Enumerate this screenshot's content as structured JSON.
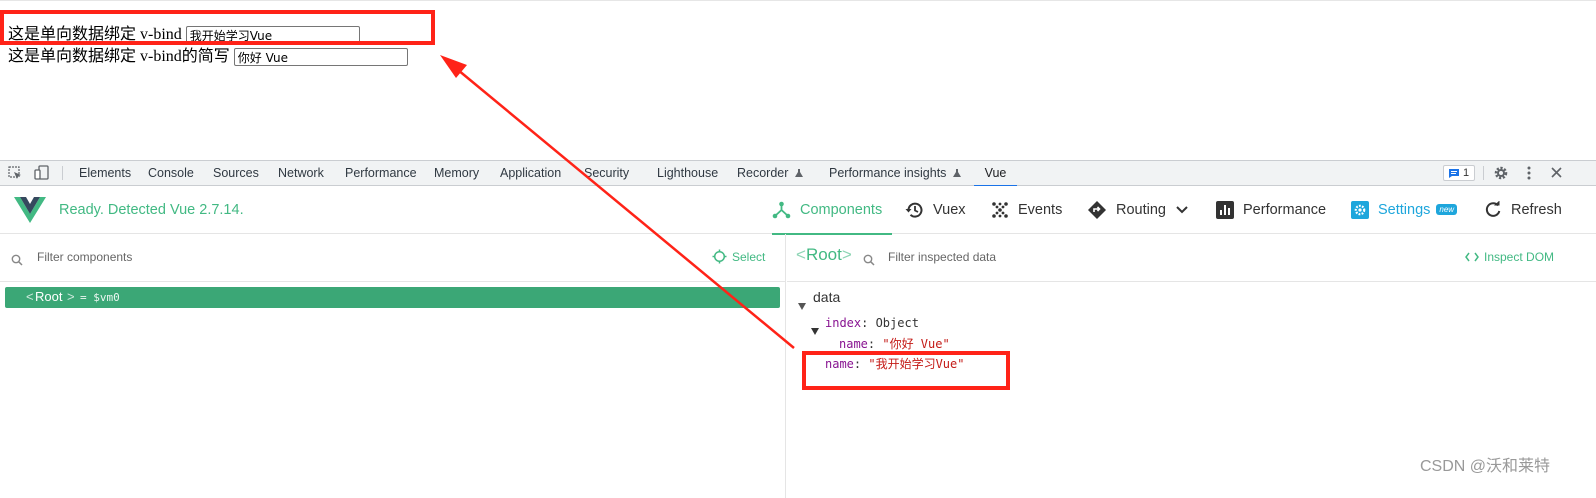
{
  "page": {
    "line1_label": "这是单向数据绑定 v-bind",
    "line1_value": "我开始学习Vue",
    "line2_label": "这是单向数据绑定 v-bind的简写",
    "line2_value": "你好 Vue"
  },
  "devtools_tabs": [
    "Elements",
    "Console",
    "Sources",
    "Network",
    "Performance",
    "Memory",
    "Application",
    "Security",
    "Lighthouse",
    "Recorder",
    "Performance insights",
    "Vue"
  ],
  "devtools_active_tab": "Vue",
  "issues_count": "1",
  "vue_header": {
    "status": "Ready. Detected Vue 2.7.14.",
    "nav": [
      "Components",
      "Vuex",
      "Events",
      "Routing",
      "Performance",
      "Settings",
      "Refresh"
    ],
    "settings_badge": "new"
  },
  "colors": {
    "vue_green": "#42b983",
    "selected_row": "#3ba776",
    "annotation_red": "#ff2318",
    "settings_blue": "#1ea6dc"
  },
  "left": {
    "filter_placeholder": "Filter components",
    "select_label": "Select",
    "root_row": {
      "tag_open": "<",
      "name": "Root",
      "tag_close": ">",
      "vm": "= $vm0"
    }
  },
  "right": {
    "root_open": "<",
    "root_name": "Root",
    "root_close": ">",
    "filter_placeholder": "Filter inspected data",
    "inspect_dom": "Inspect DOM",
    "section": "data",
    "index_key": "index",
    "index_type": "Object",
    "nested_name_key": "name",
    "nested_name_value": "\"你好 Vue\"",
    "name_key": "name",
    "name_value": "\"我开始学习Vue\""
  },
  "watermark": "CSDN @沃和莱特"
}
